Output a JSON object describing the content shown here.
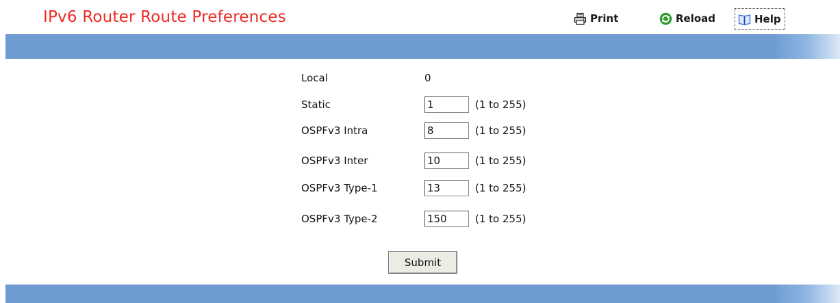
{
  "header": {
    "title": "IPv6 Router Route Preferences",
    "print_label": "Print",
    "reload_label": "Reload",
    "help_label": "Help"
  },
  "icons": {
    "print": "printer-icon",
    "reload": "reload-icon",
    "help": "help-book-icon"
  },
  "colors": {
    "title": "#ee2a24",
    "band": "#6e9bd0",
    "reload_icon": "#2e9b2e",
    "help_icon": "#3b6fd0"
  },
  "form": {
    "local": {
      "label": "Local",
      "value": "0"
    },
    "static": {
      "label": "Static",
      "value": "1",
      "range": "(1 to 255)"
    },
    "ospf_intra": {
      "label": "OSPFv3 Intra",
      "value": "8",
      "range": "(1 to 255)"
    },
    "ospf_inter": {
      "label": "OSPFv3 Inter",
      "value": "10",
      "range": "(1 to 255)"
    },
    "ospf_type1": {
      "label": "OSPFv3 Type-1",
      "value": "13",
      "range": "(1 to 255)"
    },
    "ospf_type2": {
      "label": "OSPFv3 Type-2",
      "value": "150",
      "range": "(1 to 255)"
    },
    "submit_label": "Submit"
  }
}
